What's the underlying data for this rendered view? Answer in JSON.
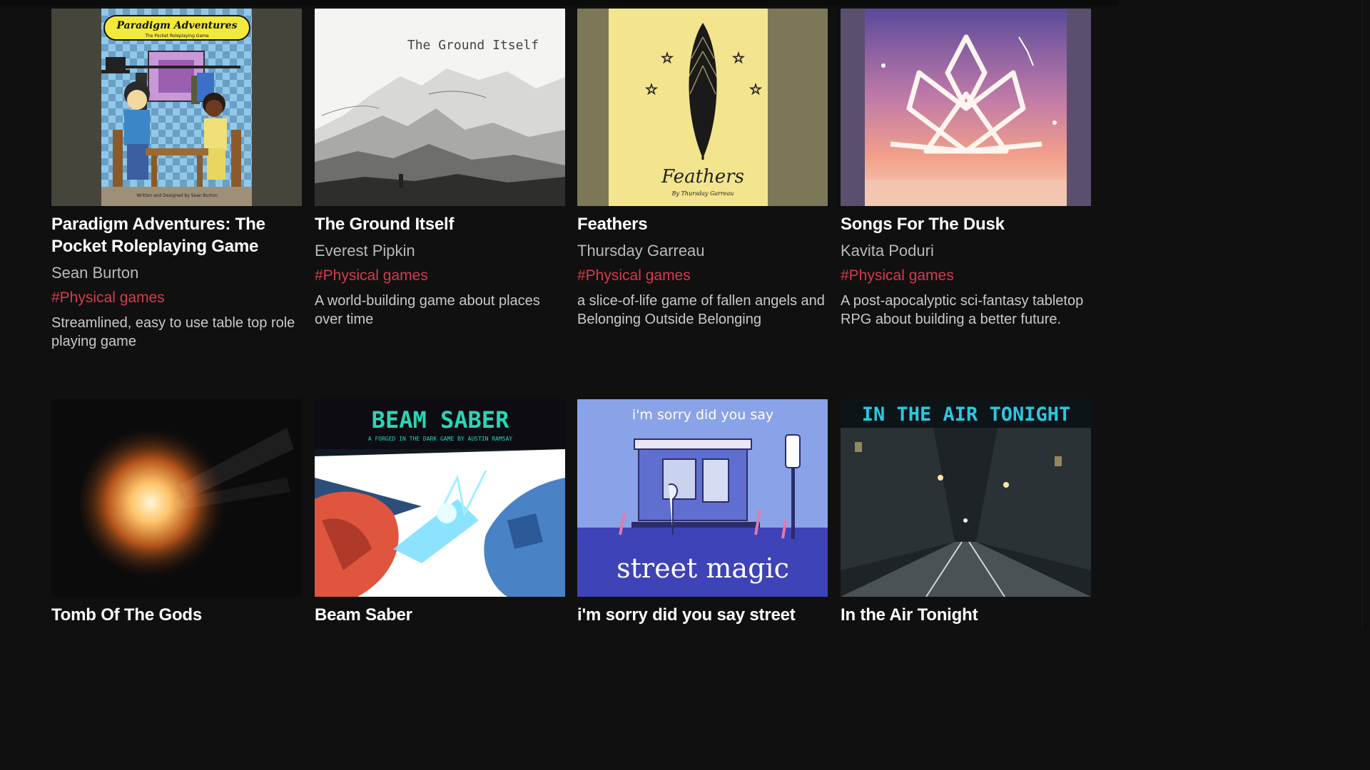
{
  "games": [
    {
      "title": "Paradigm Adventures: The Pocket Roleplaying Game",
      "author": "Sean Burton",
      "genre": "#Physical games",
      "description": "Streamlined, easy to use table top role playing game",
      "cover_title": "Paradigm Adventures",
      "cover_subtitle": "The Pocket Roleplaying Game",
      "cover_credit": "Written and Designed by Sean Burton"
    },
    {
      "title": "The Ground Itself",
      "author": "Everest Pipkin",
      "genre": "#Physical games",
      "description": "A world-building game about places over time",
      "cover_title": "The Ground Itself"
    },
    {
      "title": "Feathers",
      "author": "Thursday Garreau",
      "genre": "#Physical games",
      "description": "a slice-of-life game of fallen angels and Belonging Outside Belonging",
      "cover_title": "Feathers",
      "cover_credit": "By Thursday Garreau"
    },
    {
      "title": "Songs For The Dusk",
      "author": "Kavita Poduri",
      "genre": "#Physical games",
      "description": "A post-apocalyptic sci-fantasy tabletop RPG about building a better future."
    },
    {
      "title": "Tomb Of The Gods"
    },
    {
      "title": "Beam Saber",
      "cover_title": "BEAM SABER",
      "cover_subtitle": "A FORGED IN THE DARK GAME BY AUSTIN RAMSAY"
    },
    {
      "title": "i'm sorry did you say street",
      "cover_title_top": "i'm sorry did you say",
      "cover_title_bottom": "street magic"
    },
    {
      "title": "In the Air Tonight",
      "cover_title": "IN THE AIR TONIGHT"
    }
  ],
  "colors": {
    "background": "#101010",
    "genre": "#d43b4f",
    "author": "#b9b9b9"
  }
}
